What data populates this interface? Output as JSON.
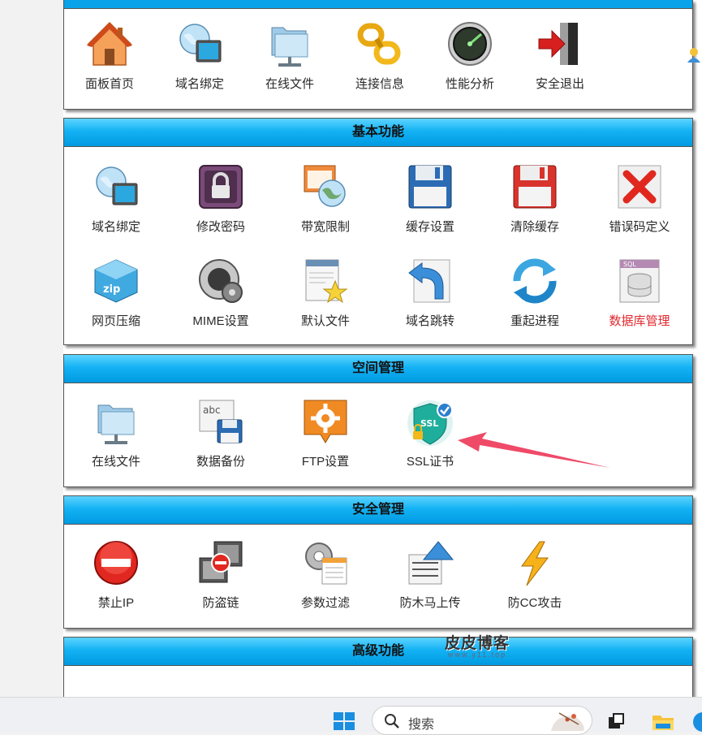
{
  "top_nav": {
    "header_partial": "......（...）",
    "items": [
      {
        "label": "面板首页",
        "icon": "house-icon"
      },
      {
        "label": "域名绑定",
        "icon": "globe-monitor-icon"
      },
      {
        "label": "在线文件",
        "icon": "network-folder-icon"
      },
      {
        "label": "连接信息",
        "icon": "chain-link-icon"
      },
      {
        "label": "性能分析",
        "icon": "radar-gauge-icon"
      },
      {
        "label": "安全退出",
        "icon": "exit-door-icon"
      }
    ]
  },
  "basic": {
    "title": "基本功能",
    "items": [
      {
        "label": "域名绑定",
        "icon": "globe-monitor-icon"
      },
      {
        "label": "修改密码",
        "icon": "padlock-icon"
      },
      {
        "label": "带宽限制",
        "icon": "globe-window-icon"
      },
      {
        "label": "缓存设置",
        "icon": "floppy-blue-icon"
      },
      {
        "label": "清除缓存",
        "icon": "floppy-red-icon"
      },
      {
        "label": "错误码定义",
        "icon": "red-x-icon"
      },
      {
        "label": "网页压缩",
        "icon": "zip-box-icon"
      },
      {
        "label": "MIME设置",
        "icon": "gear-disc-icon"
      },
      {
        "label": "默认文件",
        "icon": "document-star-icon"
      },
      {
        "label": "域名跳转",
        "icon": "return-arrow-icon"
      },
      {
        "label": "重起进程",
        "icon": "refresh-arrows-icon"
      },
      {
        "label": "数据库管理",
        "icon": "sql-database-icon",
        "highlight": "#e0282e"
      }
    ]
  },
  "space": {
    "title": "空间管理",
    "items": [
      {
        "label": "在线文件",
        "icon": "network-folder-icon"
      },
      {
        "label": "数据备份",
        "icon": "abc-floppy-icon"
      },
      {
        "label": "FTP设置",
        "icon": "orange-gear-icon"
      },
      {
        "label": "SSL证书",
        "icon": "ssl-shield-icon"
      }
    ]
  },
  "security": {
    "title": "安全管理",
    "items": [
      {
        "label": "禁止IP",
        "icon": "no-entry-icon"
      },
      {
        "label": "防盗链",
        "icon": "blocked-windows-icon"
      },
      {
        "label": "参数过滤",
        "icon": "filter-gear-icon"
      },
      {
        "label": "防木马上传",
        "icon": "upload-arrow-icon"
      },
      {
        "label": "防CC攻击",
        "icon": "lightning-icon"
      }
    ]
  },
  "advanced": {
    "title": "高级功能"
  },
  "watermark": {
    "title": "皮皮博客",
    "subtitle": "www.y11.top"
  },
  "taskbar": {
    "search_placeholder": "搜索"
  }
}
